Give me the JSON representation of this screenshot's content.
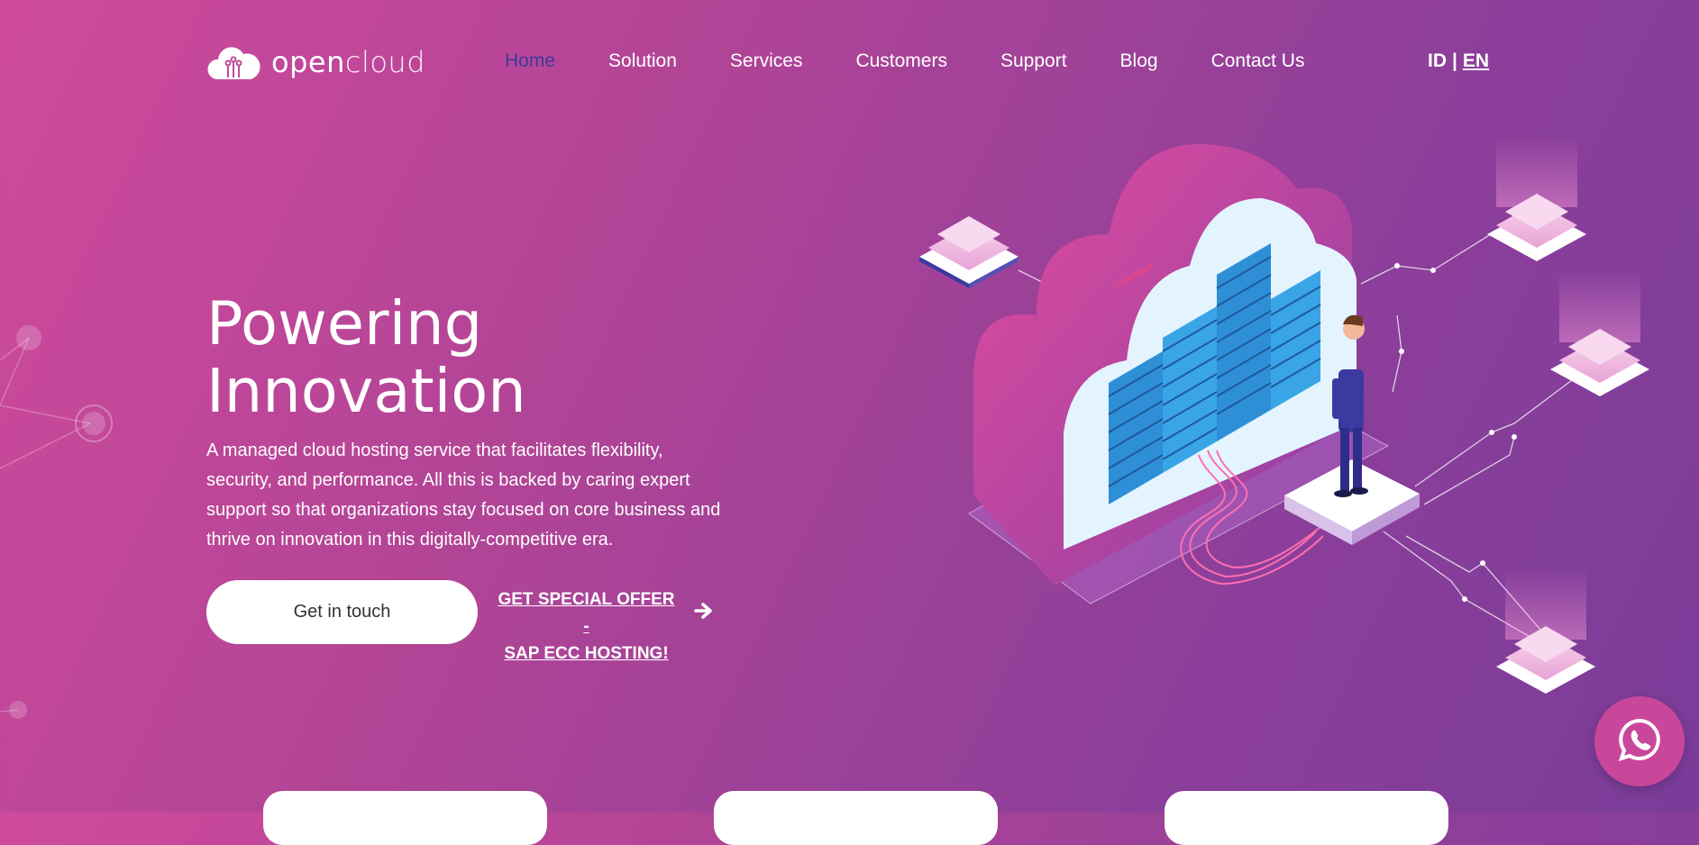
{
  "brand": {
    "name_bold": "open",
    "name_light": "cloud"
  },
  "nav": {
    "items": [
      {
        "label": "Home",
        "active": true
      },
      {
        "label": "Solution",
        "active": false
      },
      {
        "label": "Services",
        "active": false
      },
      {
        "label": "Customers",
        "active": false
      },
      {
        "label": "Support",
        "active": false
      },
      {
        "label": "Blog",
        "active": false
      },
      {
        "label": "Contact Us",
        "active": false
      }
    ]
  },
  "lang": {
    "id": "ID",
    "sep": "|",
    "en": "EN",
    "selected": "EN"
  },
  "hero": {
    "title_line1": "Powering",
    "title_line2": "Innovation",
    "description": "A managed cloud hosting service that facilitates flexibility, security, and performance. All this is backed by caring expert support so that organizations stay focused on core business and thrive on innovation in this digitally-competitive era.",
    "cta_primary": "Get in touch",
    "cta_offer_line1": "GET SPECIAL OFFER -",
    "cta_offer_line2": "SAP ECC HOSTING!"
  },
  "icons": {
    "logo": "cloud-logo-icon",
    "offer_arrow": "arrow-right-icon",
    "chat": "whatsapp-icon"
  },
  "colors": {
    "accent_active_nav": "#3d3a9e",
    "background_start": "#d04a9c",
    "background_end": "#7a3c99",
    "chat_button": "#c9479b"
  }
}
